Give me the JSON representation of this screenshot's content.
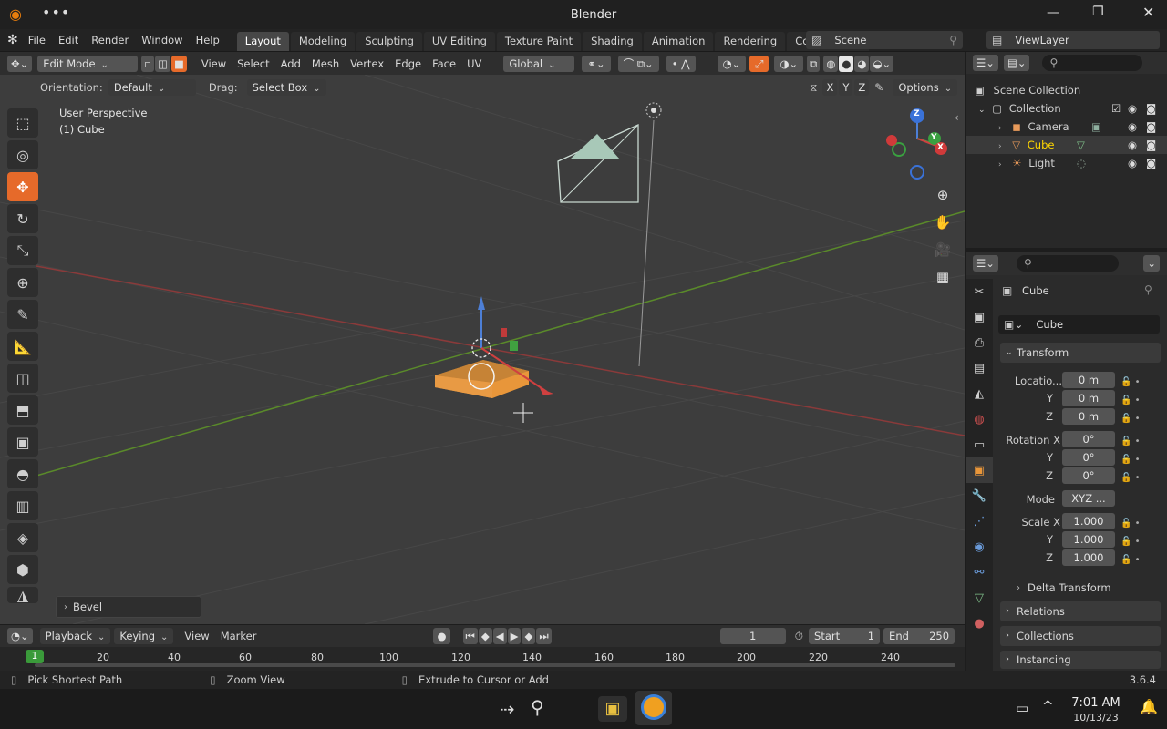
{
  "window": {
    "title": "Blender"
  },
  "menus": [
    "File",
    "Edit",
    "Render",
    "Window",
    "Help"
  ],
  "workspaces": [
    "Layout",
    "Modeling",
    "Sculpting",
    "UV Editing",
    "Texture Paint",
    "Shading",
    "Animation",
    "Rendering",
    "Compositing"
  ],
  "scene": {
    "name": "Scene",
    "view_layer": "ViewLayer"
  },
  "header3d": {
    "mode": "Edit Mode",
    "menus": [
      "View",
      "Select",
      "Add",
      "Mesh",
      "Vertex",
      "Edge",
      "Face",
      "UV"
    ],
    "transform_orientation": "Global"
  },
  "toolsettings": {
    "orientation_label": "Orientation:",
    "orientation_value": "Default",
    "drag_label": "Drag:",
    "drag_value": "Select Box",
    "axes": [
      "X",
      "Y",
      "Z"
    ],
    "options": "Options"
  },
  "viewport": {
    "perspective": "User Perspective",
    "object": "(1) Cube",
    "last_op": "Bevel",
    "gizmo": {
      "z": "Z",
      "y": "Y",
      "x": "X"
    }
  },
  "outliner": {
    "title": "Scene Collection",
    "collection": "Collection",
    "items": [
      {
        "name": "Camera",
        "selected": false
      },
      {
        "name": "Cube",
        "selected": true
      },
      {
        "name": "Light",
        "selected": false
      }
    ]
  },
  "properties": {
    "object_name": "Cube",
    "data_name": "Cube",
    "transform_label": "Transform",
    "location_label": "Locatio...",
    "location": [
      "0 m",
      "0 m",
      "0 m"
    ],
    "rotation_label": "Rotation X",
    "rotation": [
      "0°",
      "0°",
      "0°"
    ],
    "mode_label": "Mode",
    "mode_value": "XYZ ...",
    "scale_label": "Scale X",
    "scale": [
      "1.000",
      "1.000",
      "1.000"
    ],
    "axis_y": "Y",
    "axis_z": "Z",
    "delta_transform": "Delta Transform",
    "relations": "Relations",
    "collections": "Collections",
    "instancing": "Instancing"
  },
  "timeline": {
    "menus": [
      "Playback",
      "Keying",
      "View",
      "Marker"
    ],
    "current_frame": "1",
    "start_label": "Start",
    "start": "1",
    "end_label": "End",
    "end": "250",
    "ruler": [
      "1",
      "20",
      "40",
      "60",
      "80",
      "100",
      "120",
      "140",
      "160",
      "180",
      "200",
      "220",
      "240"
    ]
  },
  "statusbar": {
    "hint1": "Pick Shortest Path",
    "hint2": "Zoom View",
    "hint3": "Extrude to Cursor or Add",
    "version": "3.6.4"
  },
  "taskbar": {
    "time": "7:01 AM",
    "date": "10/13/23"
  },
  "colors": {
    "accent": "#e66a2a",
    "selected_text": "#ffd700",
    "bg": "#3d3d3d"
  }
}
